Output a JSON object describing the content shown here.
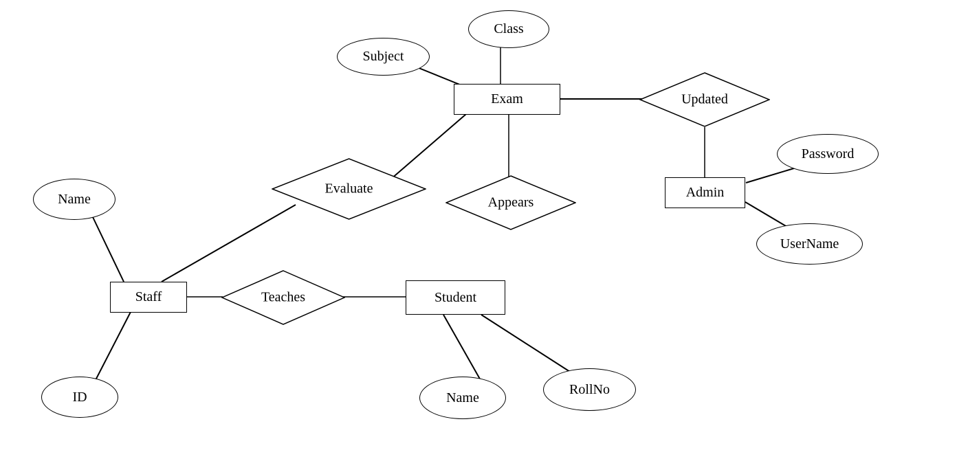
{
  "diagram": {
    "type": "er",
    "entities": {
      "exam": "Exam",
      "student": "Student",
      "staff": "Staff",
      "admin": "Admin"
    },
    "attributes": {
      "class": "Class",
      "subject": "Subject",
      "name_staff": "Name",
      "id_staff": "ID",
      "name_student": "Name",
      "rollno": "RollNo",
      "password": "Password",
      "username": "UserName"
    },
    "relationships": {
      "evaluate": "Evaluate",
      "appears": "Appears",
      "teaches": "Teaches",
      "updated": "Updated"
    },
    "edges": [
      [
        "exam",
        "class"
      ],
      [
        "exam",
        "subject"
      ],
      [
        "exam",
        "evaluate"
      ],
      [
        "exam",
        "appears"
      ],
      [
        "exam",
        "updated"
      ],
      [
        "updated",
        "admin"
      ],
      [
        "admin",
        "password"
      ],
      [
        "admin",
        "username"
      ],
      [
        "appears",
        "student"
      ],
      [
        "teaches",
        "student"
      ],
      [
        "teaches",
        "staff"
      ],
      [
        "evaluate",
        "staff"
      ],
      [
        "staff",
        "name_staff"
      ],
      [
        "staff",
        "id_staff"
      ],
      [
        "student",
        "name_student"
      ],
      [
        "student",
        "rollno"
      ]
    ]
  }
}
